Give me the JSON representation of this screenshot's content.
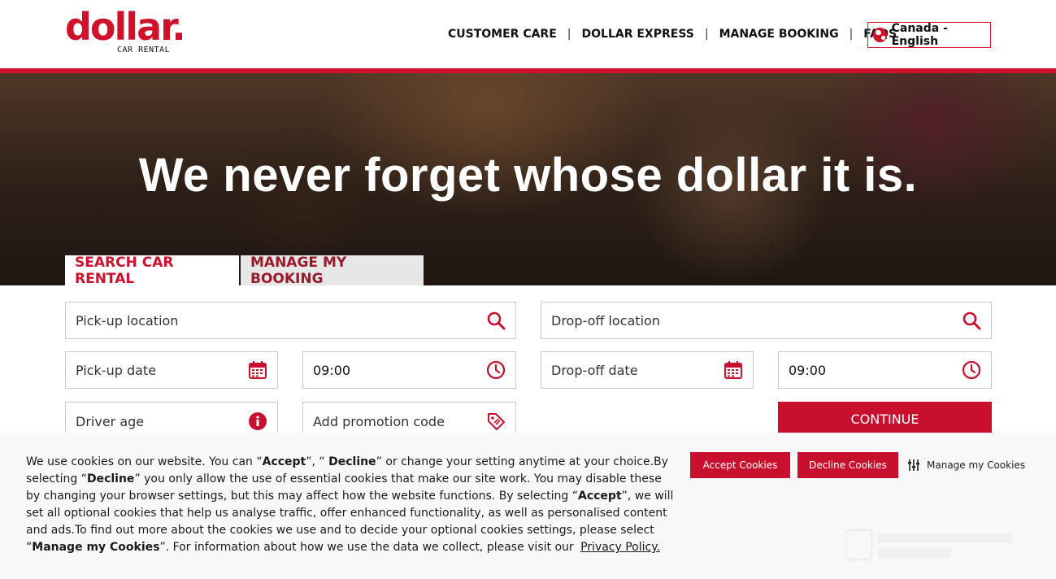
{
  "brand": {
    "logo_word": "dollar.",
    "logo_sub": "CAR RENTAL",
    "accent": "#d0112b"
  },
  "nav": {
    "items": [
      "CUSTOMER CARE",
      "DOLLAR EXPRESS",
      "MANAGE BOOKING",
      "FAQS"
    ],
    "separator": "|",
    "locale": "Canada - English"
  },
  "hero": {
    "title": "We never forget whose dollar it is."
  },
  "tabs": {
    "search": "SEARCH CAR RENTAL",
    "manage": "MANAGE MY BOOKING"
  },
  "form": {
    "pickup_location": "Pick-up location",
    "dropoff_location": "Drop-off location",
    "pickup_date": "Pick-up date",
    "pickup_time": "09:00",
    "dropoff_date": "Drop-off date",
    "dropoff_time": "09:00",
    "driver_age": "Driver age",
    "promo": "Add promotion code",
    "continue": "CONTINUE"
  },
  "cookies": {
    "t1": "We use cookies on our website. You can “",
    "accept_word": "Accept",
    "t2": "”, “ ",
    "decline_word": "Decline",
    "t3": "” or change your setting anytime at your choice.By selecting “",
    "decline_word2": "Decline",
    "t4": "” you only allow the use of essential cookies that make our site work. You may disable these by changing your browser settings, but this may affect how the website functions. By selecting “",
    "accept_word2": "Accept",
    "t5": "”, we will set all optional cookies that help us analyse traffic, offer enhanced functionality, as well as personalised content and ads.To find out more about the cookies we use and to decide your optional cookies settings, please select “",
    "manage_word": "Manage my Cookies",
    "t6": "”. For information about how we use the data we collect, please visit our ",
    "privacy_link": "Privacy Policy.",
    "accept_button": "Accept Cookies",
    "decline_button": "Decline Cookies",
    "manage_button": "Manage my Cookies"
  }
}
